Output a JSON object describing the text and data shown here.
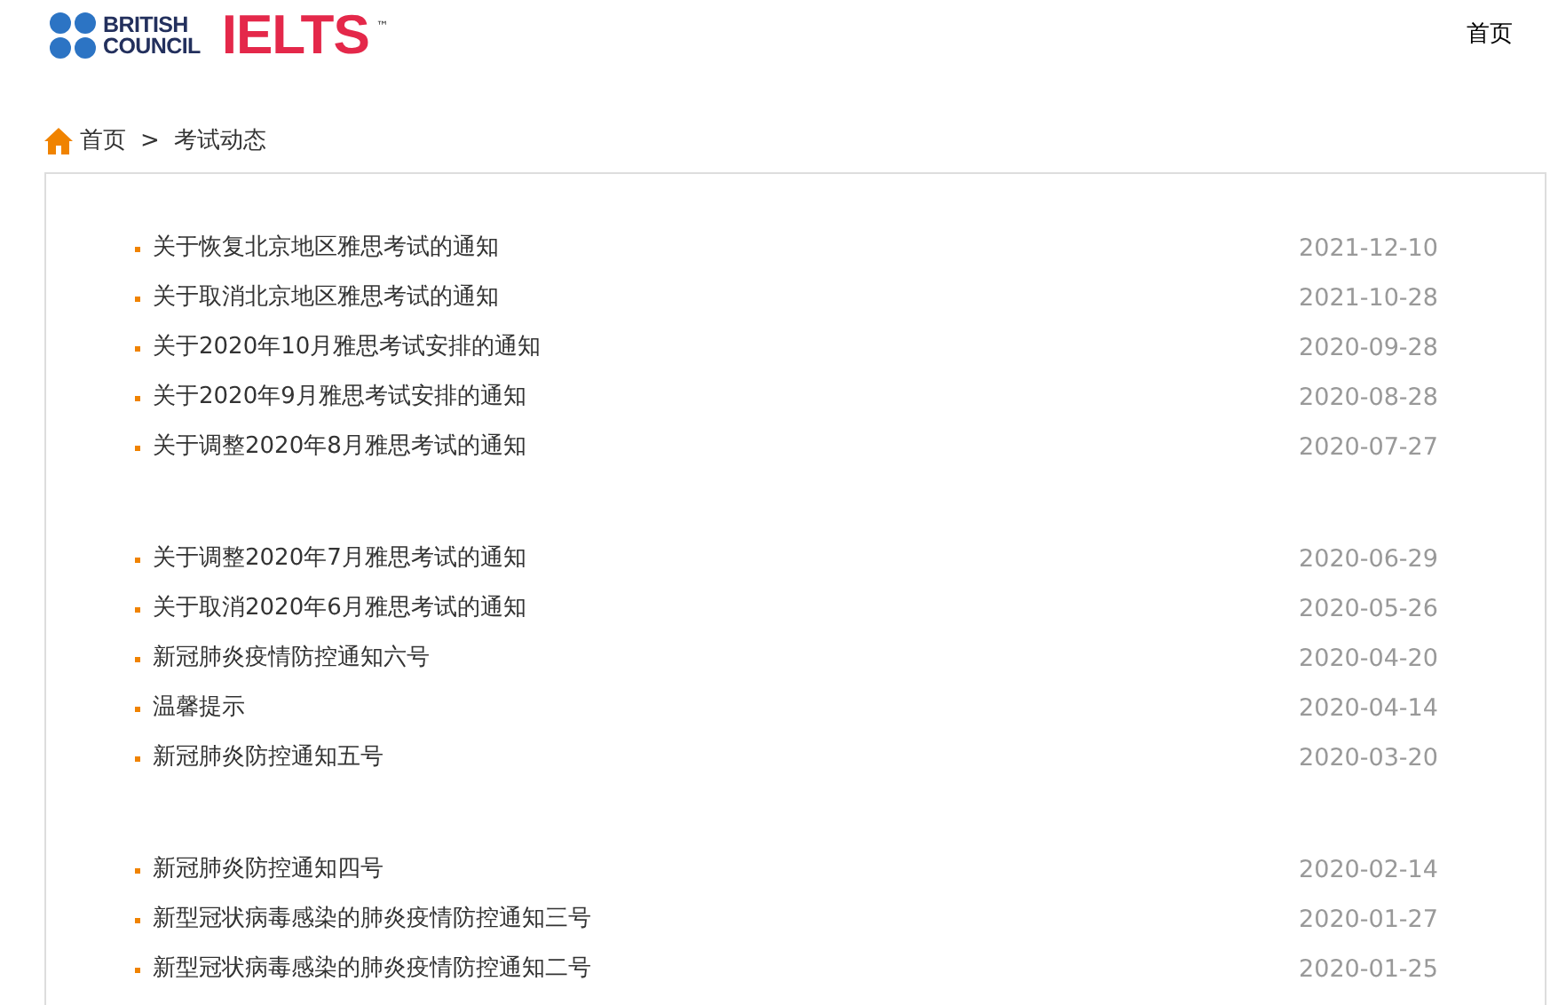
{
  "header": {
    "logo": {
      "org_line_1": "BRITISH",
      "org_line_2": "COUNCIL",
      "product": "IELTS",
      "trademark": "™"
    },
    "nav": [
      "首页"
    ]
  },
  "breadcrumb": {
    "items": [
      "首页",
      "考试动态"
    ],
    "separator": ">"
  },
  "news_groups": [
    {
      "items": [
        {
          "title": "关于恢复北京地区雅思考试的通知",
          "date": "2021-12-10"
        },
        {
          "title": "关于取消北京地区雅思考试的通知",
          "date": "2021-10-28"
        },
        {
          "title": "关于2020年10月雅思考试安排的通知",
          "date": "2020-09-28"
        },
        {
          "title": "关于2020年9月雅思考试安排的通知",
          "date": "2020-08-28"
        },
        {
          "title": "关于调整2020年8月雅思考试的通知",
          "date": "2020-07-27"
        }
      ]
    },
    {
      "items": [
        {
          "title": "关于调整2020年7月雅思考试的通知",
          "date": "2020-06-29"
        },
        {
          "title": "关于取消2020年6月雅思考试的通知",
          "date": "2020-05-26"
        },
        {
          "title": "新冠肺炎疫情防控通知六号",
          "date": "2020-04-20"
        },
        {
          "title": "温馨提示",
          "date": "2020-04-14"
        },
        {
          "title": "新冠肺炎防控通知五号",
          "date": "2020-03-20"
        }
      ]
    },
    {
      "items": [
        {
          "title": "新冠肺炎防控通知四号",
          "date": "2020-02-14"
        },
        {
          "title": "新型冠状病毒感染的肺炎疫情防控通知三号",
          "date": "2020-01-27"
        },
        {
          "title": "新型冠状病毒感染的肺炎疫情防控通知二号",
          "date": "2020-01-25"
        }
      ]
    }
  ]
}
